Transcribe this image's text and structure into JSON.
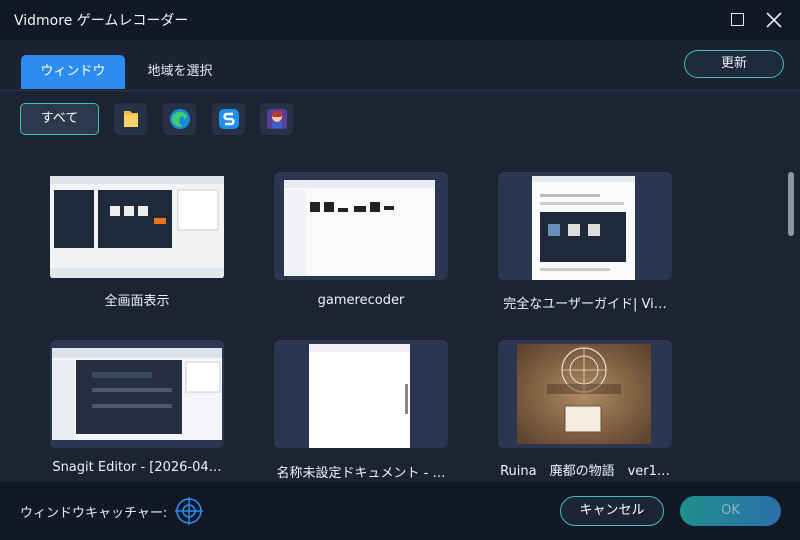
{
  "window": {
    "title": "Vidmore ゲームレコーダー",
    "maximize_icon": "maximize-icon",
    "close_icon": "close-icon"
  },
  "tabs": [
    {
      "label": "ウィンドウ",
      "active": true
    },
    {
      "label": "地域を選択",
      "active": false
    }
  ],
  "refresh_label": "更新",
  "filters": {
    "all_label": "すべて",
    "apps": [
      "folder-icon",
      "edge-icon",
      "snagit-icon",
      "game-icon"
    ]
  },
  "windows": [
    {
      "label": "全画面表示"
    },
    {
      "label": "gamerecoder"
    },
    {
      "label": "完全なユーザーガイド| Vi…"
    },
    {
      "label": "Snagit Editor - [2026-04…"
    },
    {
      "label": "名称未設定ドキュメント - …"
    },
    {
      "label": "Ruina　廃都の物語　ver1…"
    }
  ],
  "footer": {
    "catcher_label": "ウィンドウキャッチャー:",
    "cancel_label": "キャンセル",
    "ok_label": "OK"
  },
  "colors": {
    "accent_blue": "#2d8cf0",
    "accent_teal": "#3fbfb6",
    "background": "#1c2433",
    "titlebar": "#121926"
  }
}
